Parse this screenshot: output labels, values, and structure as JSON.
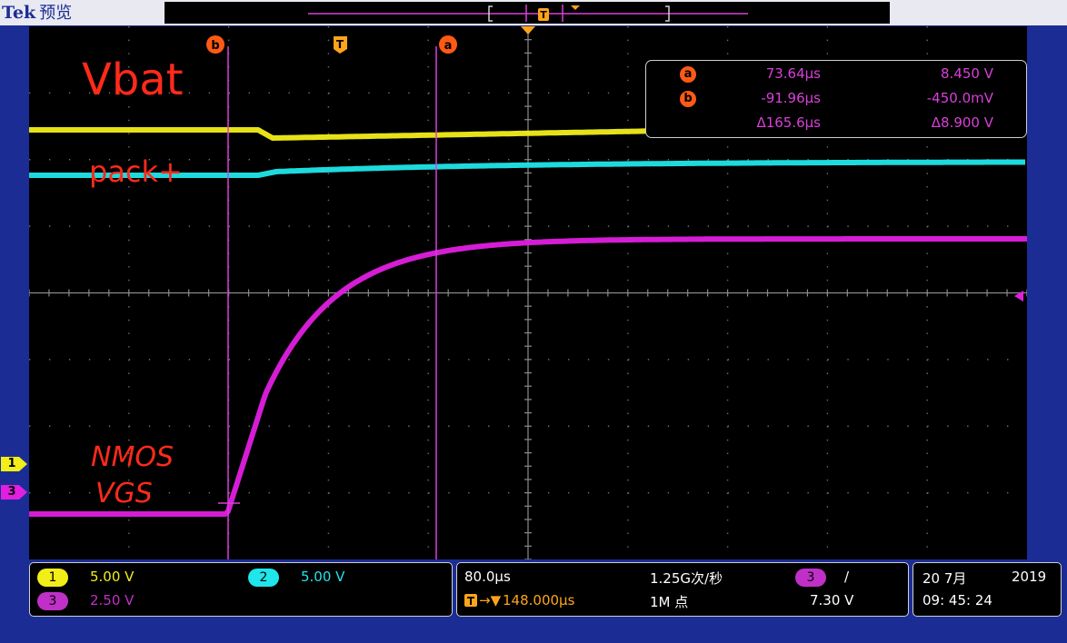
{
  "header": {
    "brand": "Tek",
    "mode": "预览",
    "trigger_position_marker": "T"
  },
  "graticule": {
    "horizontal_divisions": 10,
    "vertical_divisions": 8
  },
  "cursors": {
    "a": {
      "label": "a",
      "time": "73.64µs",
      "value": "8.450 V"
    },
    "b": {
      "label": "b",
      "time": "-91.96µs",
      "value": "-450.0mV"
    },
    "delta": {
      "time": "Δ165.6µs",
      "value": "Δ8.900 V"
    },
    "trigger_marker": "T"
  },
  "annotations": {
    "vbat": "Vbat",
    "pack": "pack+",
    "nmos": "NMOS",
    "vgs": "VGS"
  },
  "channel_markers": {
    "ch1": "1",
    "ch3": "3"
  },
  "colors": {
    "ch1": "#f2ee18",
    "ch2": "#1fe6ea",
    "ch3": "#e01fe0",
    "cursor_marker": "#ff5a14",
    "trigger": "#ffa41a",
    "annotation": "#ff2a1a"
  },
  "channels": [
    {
      "id": "1",
      "scale": "5.00 V"
    },
    {
      "id": "2",
      "scale": "5.00 V"
    },
    {
      "id": "3",
      "scale": "2.50 V"
    }
  ],
  "horizontal": {
    "time_per_div": "80.0µs",
    "sample_rate": "1.25G次/秒",
    "record_length": "1M 点",
    "trigger_position": "148.000µs"
  },
  "trigger": {
    "source": "3",
    "slope": "/",
    "level": "7.30 V"
  },
  "datetime": {
    "date": "20 7月",
    "year": "2019",
    "time": "09: 45: 24"
  }
}
